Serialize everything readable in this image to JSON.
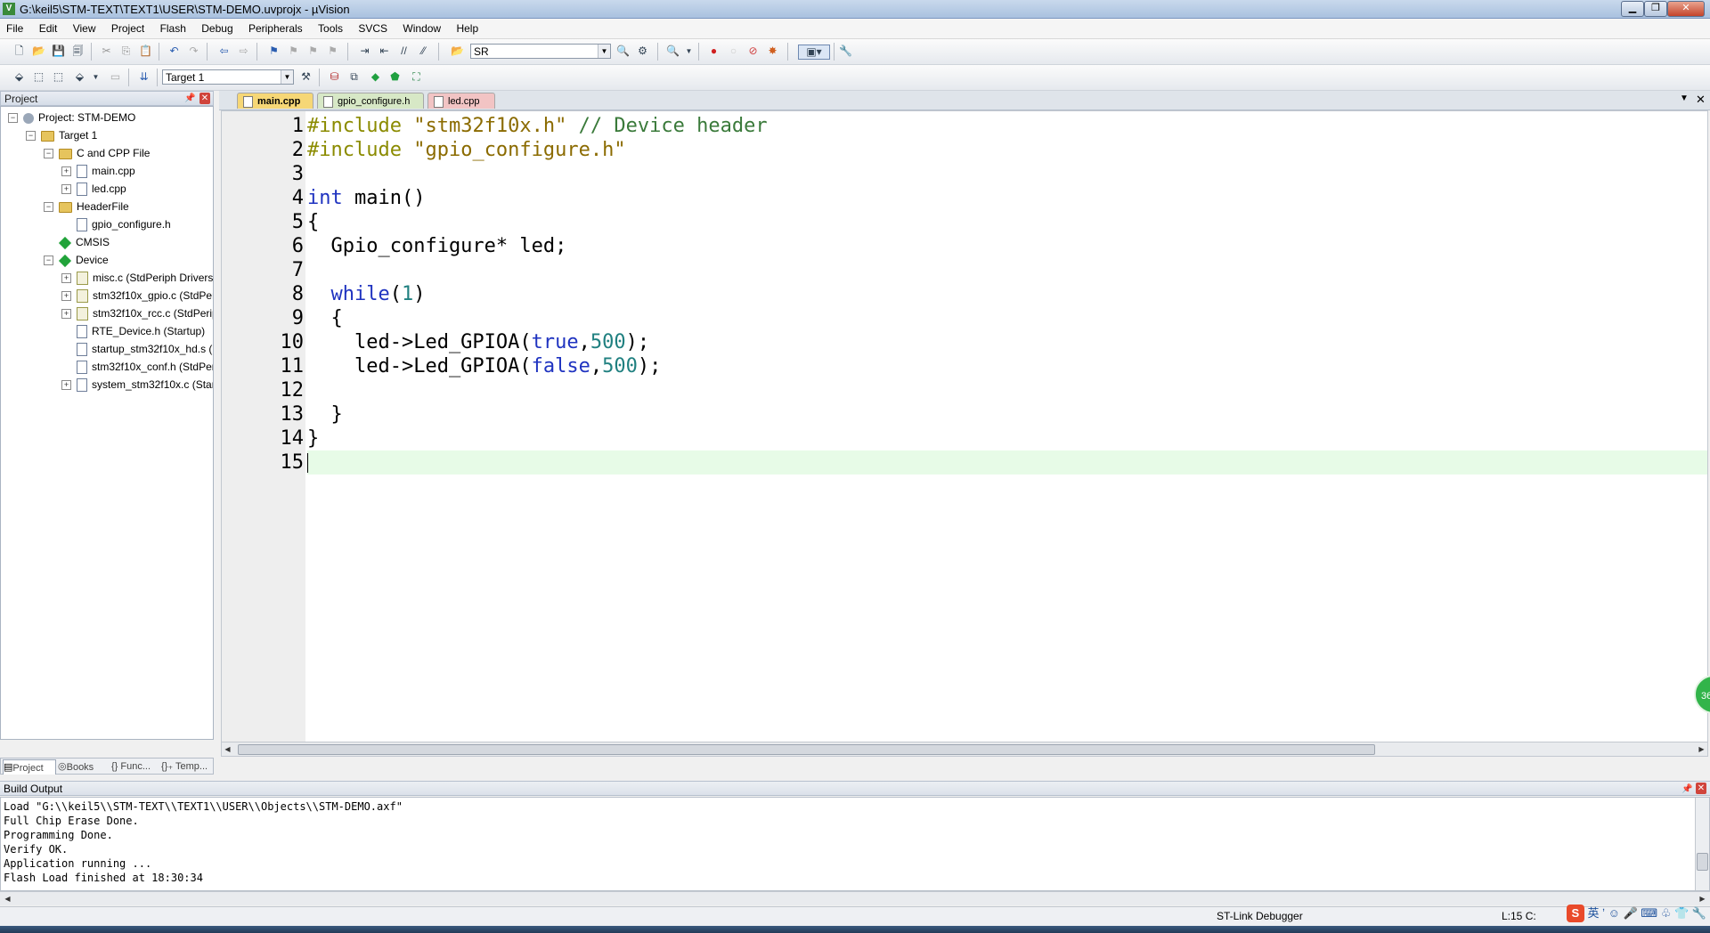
{
  "window": {
    "title": "G:\\keil5\\STM-TEXT\\TEXT1\\USER\\STM-DEMO.uvprojx - µVision"
  },
  "menu": [
    "File",
    "Edit",
    "View",
    "Project",
    "Flash",
    "Debug",
    "Peripherals",
    "Tools",
    "SVCS",
    "Window",
    "Help"
  ],
  "toolbar": {
    "find_value": "SR",
    "target_value": "Target 1"
  },
  "project_panel": {
    "title": "Project",
    "tree": [
      {
        "label": "Project: STM-DEMO"
      },
      {
        "label": "Target 1"
      },
      {
        "label": "C and CPP File"
      },
      {
        "label": "main.cpp"
      },
      {
        "label": "led.cpp"
      },
      {
        "label": "HeaderFile"
      },
      {
        "label": "gpio_configure.h"
      },
      {
        "label": "CMSIS"
      },
      {
        "label": "Device"
      },
      {
        "label": "misc.c (StdPeriph Drivers"
      },
      {
        "label": "stm32f10x_gpio.c (StdPer"
      },
      {
        "label": "stm32f10x_rcc.c (StdPerip"
      },
      {
        "label": "RTE_Device.h (Startup)"
      },
      {
        "label": "startup_stm32f10x_hd.s ("
      },
      {
        "label": "stm32f10x_conf.h (StdPer"
      },
      {
        "label": "system_stm32f10x.c (Star"
      }
    ],
    "bottom_tabs": [
      "Project",
      "Books",
      "{} Func...",
      "{}₊ Temp..."
    ]
  },
  "editor": {
    "tabs": [
      "main.cpp",
      "gpio_configure.h",
      "led.cpp"
    ],
    "lines": [
      "1",
      "2",
      "3",
      "4",
      "5",
      "6",
      "7",
      "8",
      "9",
      "10",
      "11",
      "12",
      "13",
      "14",
      "15"
    ]
  },
  "build_output": {
    "title": "Build Output",
    "lines": [
      "Load \"G:\\\\keil5\\\\STM-TEXT\\\\TEXT1\\\\USER\\\\Objects\\\\STM-DEMO.axf\"",
      "Full Chip Erase Done.",
      "Programming Done.",
      "Verify OK.",
      "Application running ...",
      "Flash Load finished at 18:30:34"
    ]
  },
  "status": {
    "debugger": "ST-Link Debugger",
    "cursor": "L:15 C:"
  },
  "floating_badge": "36",
  "tray_ime": "英"
}
